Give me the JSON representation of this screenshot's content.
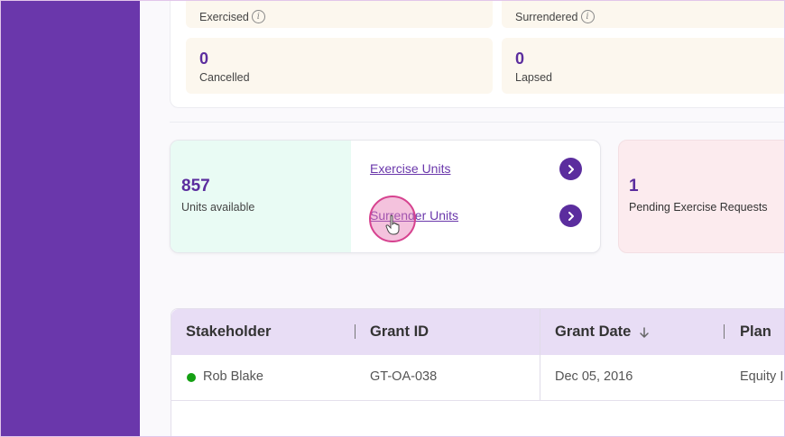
{
  "stats": {
    "exercised_label": "Exercised",
    "surrendered_label": "Surrendered",
    "cancelled_value": "0",
    "cancelled_label": "Cancelled",
    "lapsed_value": "0",
    "lapsed_label": "Lapsed"
  },
  "units": {
    "available_value": "857",
    "available_label": "Units available",
    "exercise_link": "Exercise Units",
    "surrender_link": "Surrender Units"
  },
  "pending": {
    "value": "1",
    "label": "Pending Exercise Requests"
  },
  "table": {
    "headers": [
      "Stakeholder",
      "Grant ID",
      "Grant Date",
      "Plan"
    ],
    "rows": [
      {
        "stakeholder": "Rob Blake",
        "grant_id": "GT-OA-038",
        "grant_date": "Dec 05, 2016",
        "plan": "Equity In"
      }
    ]
  },
  "colors": {
    "sidebar": "#6a37ab",
    "accent": "#5b2d9e",
    "status_active": "#14a013"
  }
}
